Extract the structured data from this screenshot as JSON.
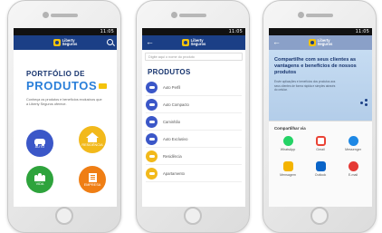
{
  "status_time": "11:05",
  "brand": {
    "line1": "Liberty",
    "line2": "Seguros",
    "primary": "#1b3f86",
    "accent": "#f4c30c"
  },
  "screen1": {
    "title_line1": "PORTFÓLIO DE",
    "title_line2": "PRODUTOS",
    "description": "Conheça os produtos e benefícios exclusivos que a Liberty Seguros oferece.",
    "products": [
      {
        "label": "AUTO",
        "icon": "car-icon",
        "color": "#3b57c8"
      },
      {
        "label": "RESIDÊNCIA",
        "icon": "house-icon",
        "color": "#f2b91b"
      },
      {
        "label": "VIDA",
        "icon": "people-icon",
        "color": "#2ea33c"
      },
      {
        "label": "EMPRESA",
        "icon": "building-icon",
        "color": "#ef7e14"
      }
    ]
  },
  "screen2": {
    "search_placeholder": "Digite aqui o nome do produto",
    "heading": "PRODUTOS",
    "items": [
      {
        "label": "Auto Perfil",
        "color": "#3b57c8"
      },
      {
        "label": "Auto Compacto",
        "color": "#3b57c8"
      },
      {
        "label": "Caminhão",
        "color": "#3b57c8"
      },
      {
        "label": "Auto Exclusivo",
        "color": "#3b57c8"
      },
      {
        "label": "Residência",
        "color": "#f2b91b"
      },
      {
        "label": "Apartamento",
        "color": "#f2b91b"
      }
    ]
  },
  "screen3": {
    "hero_title": "Compartilhe com seus clientes as vantagens e benefícios de nossos produtos",
    "hero_text": "Envie aplicações e benefícios dos produtos aos seus clientes de forma rápida e simples através do celular.",
    "share_heading": "Compartilhar via",
    "apps": [
      {
        "label": "WhatsApp",
        "color": "#25d366"
      },
      {
        "label": "Gmail",
        "color": "#ea4335"
      },
      {
        "label": "Messenger",
        "color": "#1e88e5"
      },
      {
        "label": "Mensagem",
        "color": "#f4b400"
      },
      {
        "label": "Outlook",
        "color": "#0a64c8"
      },
      {
        "label": "E-mail",
        "color": "#e53935"
      }
    ]
  }
}
